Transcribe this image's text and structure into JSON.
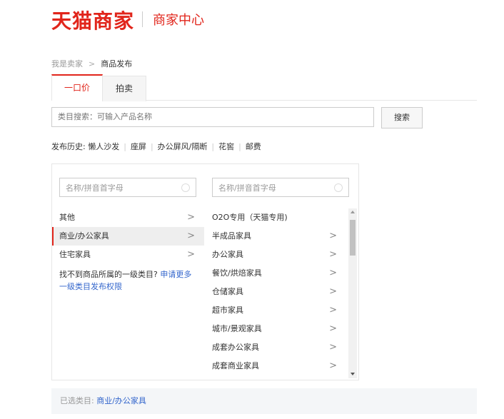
{
  "header": {
    "logo": "天猫商家",
    "subtitle": "商家中心"
  },
  "breadcrumb": {
    "parent": "我是卖家",
    "arrow": ">",
    "current": "商品发布"
  },
  "tabs": [
    {
      "label": "一口价"
    },
    {
      "label": "拍卖"
    }
  ],
  "search": {
    "placeholder": "类目搜索：可输入产品名称",
    "button": "搜索"
  },
  "history": {
    "label": "发布历史:",
    "items": [
      "懒人沙发",
      "座屏",
      "办公屏风/隔断",
      "花窖",
      "邮费"
    ]
  },
  "panel1": {
    "filter_placeholder": "名称/拼音首字母",
    "items": [
      {
        "label": "其他",
        "chevron": ">"
      },
      {
        "label": "商业/办公家具",
        "chevron": ">"
      },
      {
        "label": "住宅家具",
        "chevron": ">"
      }
    ],
    "notfound_text": "找不到商品所属的一级类目? ",
    "notfound_link": "申请更多一级类目发布权限"
  },
  "panel2": {
    "filter_placeholder": "名称/拼音首字母",
    "items": [
      {
        "label": "O2O专用（天猫专用)",
        "chevron": ""
      },
      {
        "label": "半成品家具",
        "chevron": ">"
      },
      {
        "label": "办公家具",
        "chevron": ">"
      },
      {
        "label": "餐饮/烘焙家具",
        "chevron": ">"
      },
      {
        "label": "仓储家具",
        "chevron": ">"
      },
      {
        "label": "超市家具",
        "chevron": ">"
      },
      {
        "label": "城市/景观家具",
        "chevron": ">"
      },
      {
        "label": "成套办公家具",
        "chevron": ">"
      },
      {
        "label": "成套商业家具",
        "chevron": ">"
      }
    ]
  },
  "selected": {
    "label": "已选类目: ",
    "value": "商业/办公家具"
  },
  "colors": {
    "brand": "#e1251b",
    "link": "#3366cc"
  }
}
